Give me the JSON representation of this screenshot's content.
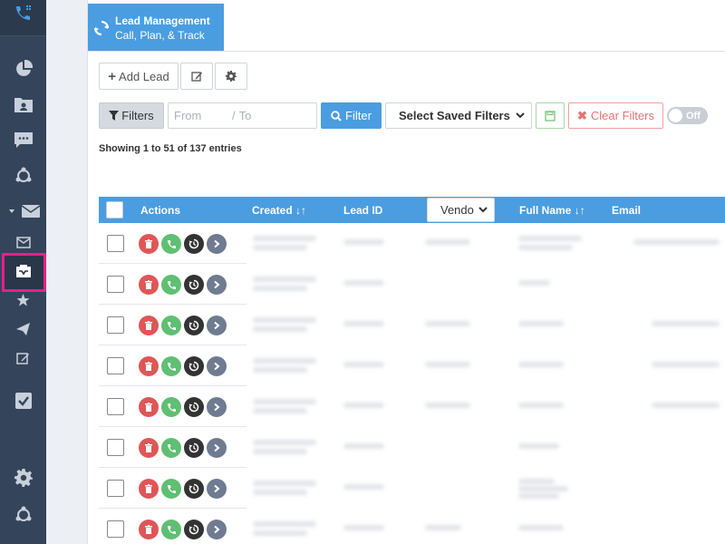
{
  "header": {
    "title": "Lead Management",
    "subtitle": "Call, Plan, & Track"
  },
  "toolbar": {
    "add_lead_label": "Add Lead",
    "filters_label": "Filters",
    "from_placeholder": "From",
    "to_placeholder": "To",
    "filter_label": "Filter",
    "saved_filters_label": "Select Saved Filters",
    "clear_filters_label": "Clear Filters",
    "toggle_label": "Off"
  },
  "table": {
    "showing_text": "Showing 1 to 51 of 137 entries",
    "columns": {
      "actions": "Actions",
      "created": "Created",
      "lead_id": "Lead ID",
      "vendor": "Vendo",
      "full_name": "Full Name",
      "email": "Email"
    },
    "row_count_visible": 8
  },
  "colors": {
    "sidebar": "#34445a",
    "accent": "#4a9de0",
    "highlight": "#e91e8c",
    "delete": "#e05656",
    "call": "#5fbf72",
    "history": "#333333",
    "go": "#6f7b90"
  }
}
